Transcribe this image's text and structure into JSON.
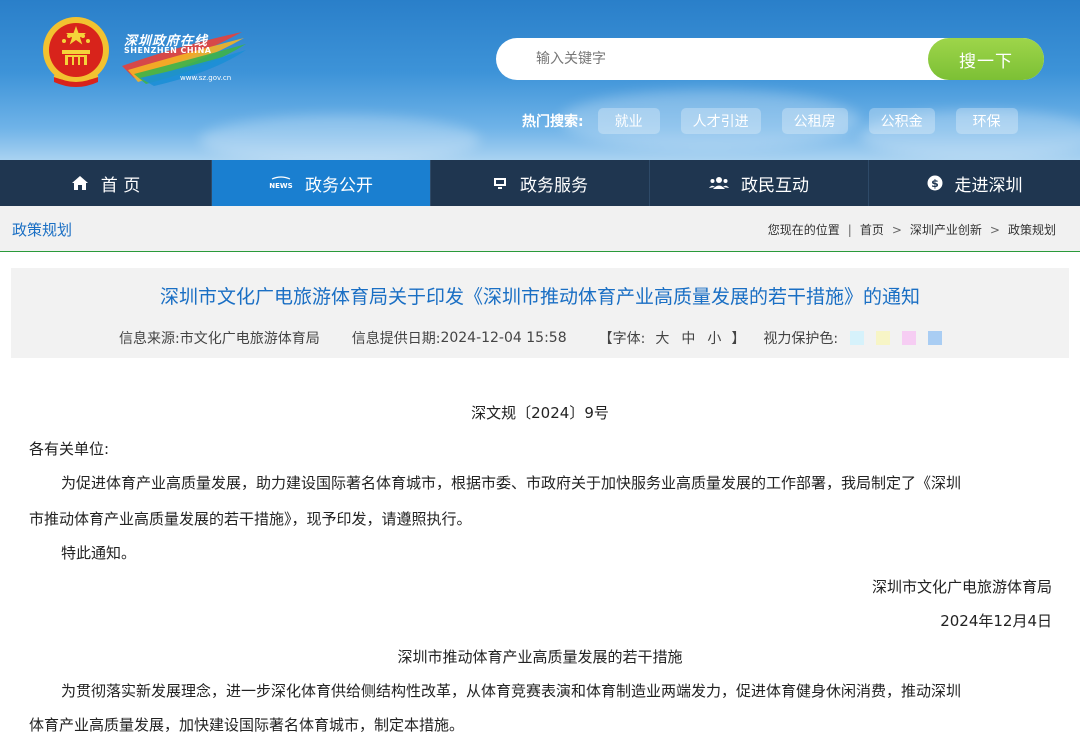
{
  "header": {
    "logo_cn": "深圳政府在线",
    "logo_en": "SHENZHEN  CHINA",
    "logo_url": "www.sz.gov.cn",
    "search_placeholder": "输入关键字",
    "search_button": "搜一下",
    "hot_label": "热门搜索:",
    "hot_tags": [
      "就业",
      "人才引进",
      "公租房",
      "公积金",
      "环保"
    ]
  },
  "nav": {
    "items": [
      {
        "label": "首 页",
        "icon": "home-icon"
      },
      {
        "label": "政务公开",
        "icon": "news-icon"
      },
      {
        "label": "政务服务",
        "icon": "monitor-icon"
      },
      {
        "label": "政民互动",
        "icon": "people-icon"
      },
      {
        "label": "走进深圳",
        "icon": "dollar-icon"
      }
    ]
  },
  "breadcrumb": {
    "section": "政策规划",
    "location_label": "您现在的位置",
    "path": [
      "首页",
      "深圳产业创新",
      "政策规划"
    ]
  },
  "article": {
    "title": "深圳市文化广电旅游体育局关于印发《深圳市推动体育产业高质量发展的若干措施》的通知",
    "source_label": "信息来源:",
    "source": "市文化广电旅游体育局",
    "date_label": "信息提供日期:",
    "date": "2024-12-04 15:58",
    "font_label": "【字体:",
    "font_large": "大",
    "font_medium": "中",
    "font_small": "小",
    "font_close": "】",
    "vision_label": "视力保护色:",
    "vision_colors": [
      "#d6f2fb",
      "#f7f5c6",
      "#f6cdf3",
      "#a9cdf3"
    ],
    "doc_number": "深文规〔2024〕9号",
    "greeting": "各有关单位:",
    "para1_line1": "为促进体育产业高质量发展，助力建设国际著名体育城市，根据市委、市政府关于加快服务业高质量发展的工作部署，我局制定了《深圳",
    "para1_line2": "市推动体育产业高质量发展的若干措施》，现予印发，请遵照执行。",
    "notice": "特此通知。",
    "signer": "深圳市文化广电旅游体育局",
    "sign_date": "2024年12月4日",
    "sub_title": "深圳市推动体育产业高质量发展的若干措施",
    "para2_line1": "为贯彻落实新发展理念，进一步深化体育供给侧结构性改革，从体育竞赛表演和体育制造业两端发力，促进体育健身休闲消费，推动深圳",
    "para2_line2": "体育产业高质量发展，加快建设国际著名体育城市，制定本措施。"
  }
}
